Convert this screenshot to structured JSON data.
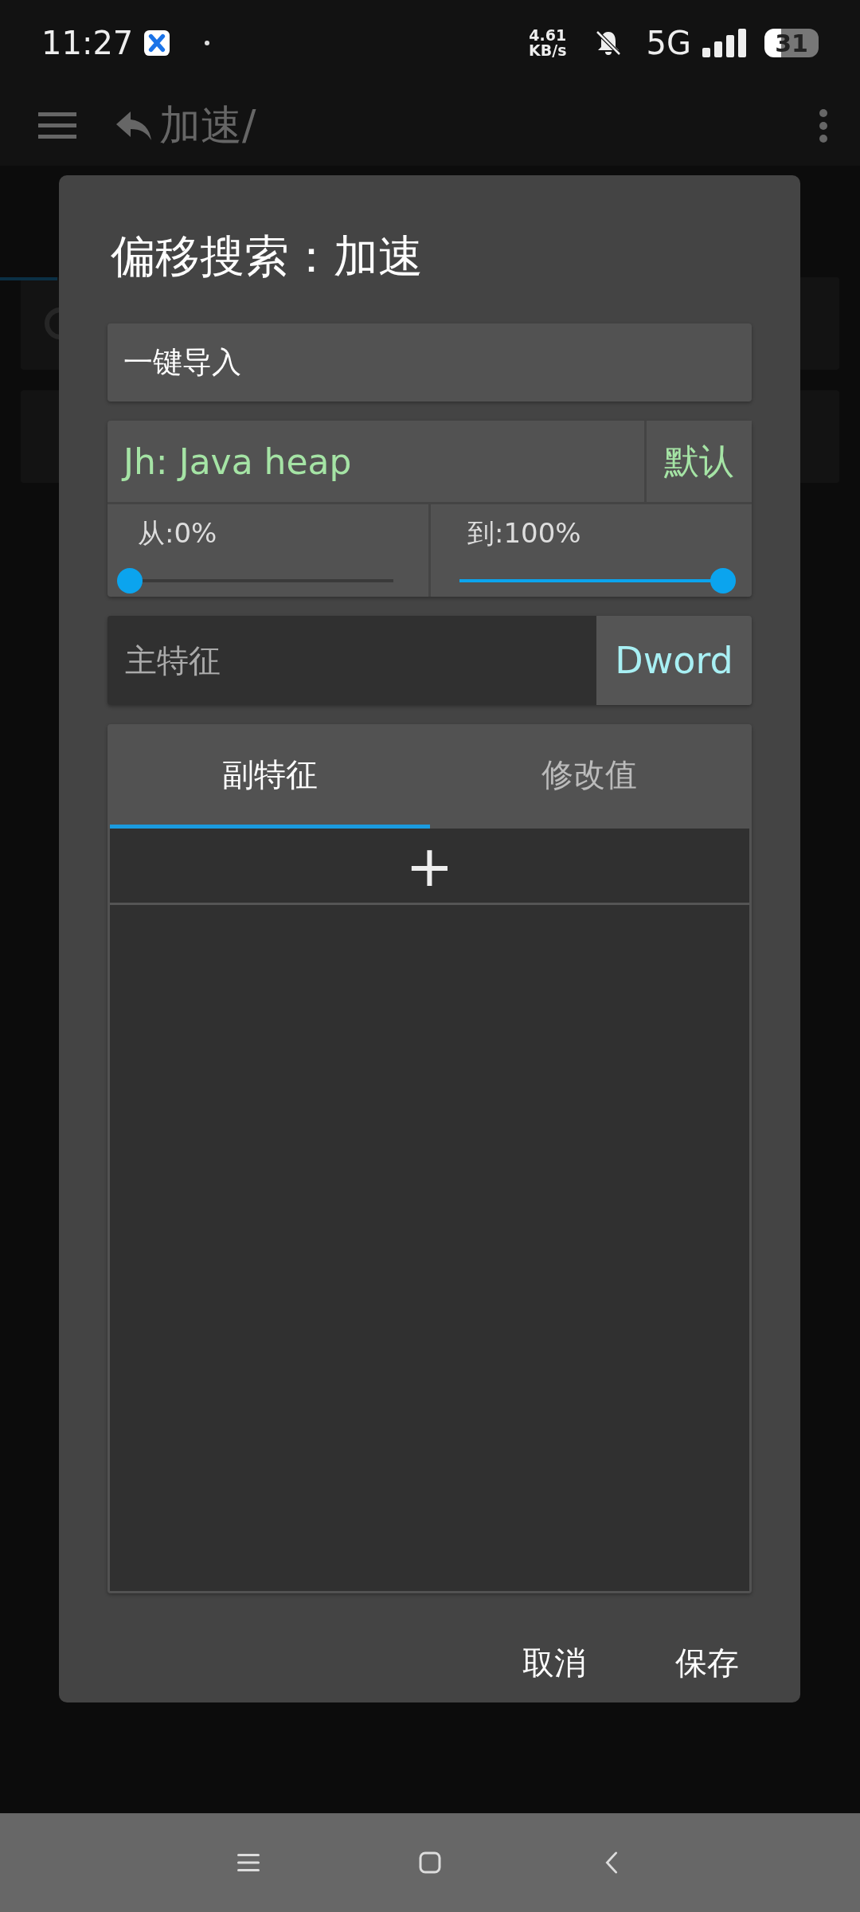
{
  "status_bar": {
    "time": "11:27",
    "speed_value": "4.61",
    "speed_unit": "KB/s",
    "network": "5G",
    "battery": "31"
  },
  "app_bar": {
    "path": "加速/"
  },
  "dialog": {
    "title": "偏移搜索：加速",
    "import_button": "一键导入",
    "memory_region": {
      "value": "Jh: Java heap",
      "default_button": "默认"
    },
    "range": [
      {
        "label": "从:0%",
        "level": 0
      },
      {
        "label": "到:100%",
        "level": 1
      }
    ],
    "main_feature": {
      "placeholder": "主特征",
      "type_button": "Dword"
    },
    "tabs": [
      {
        "label": "副特征",
        "selected": true
      },
      {
        "label": "修改值",
        "selected": false
      }
    ],
    "add_button": "+",
    "buttons": [
      "取消",
      "保存"
    ]
  }
}
